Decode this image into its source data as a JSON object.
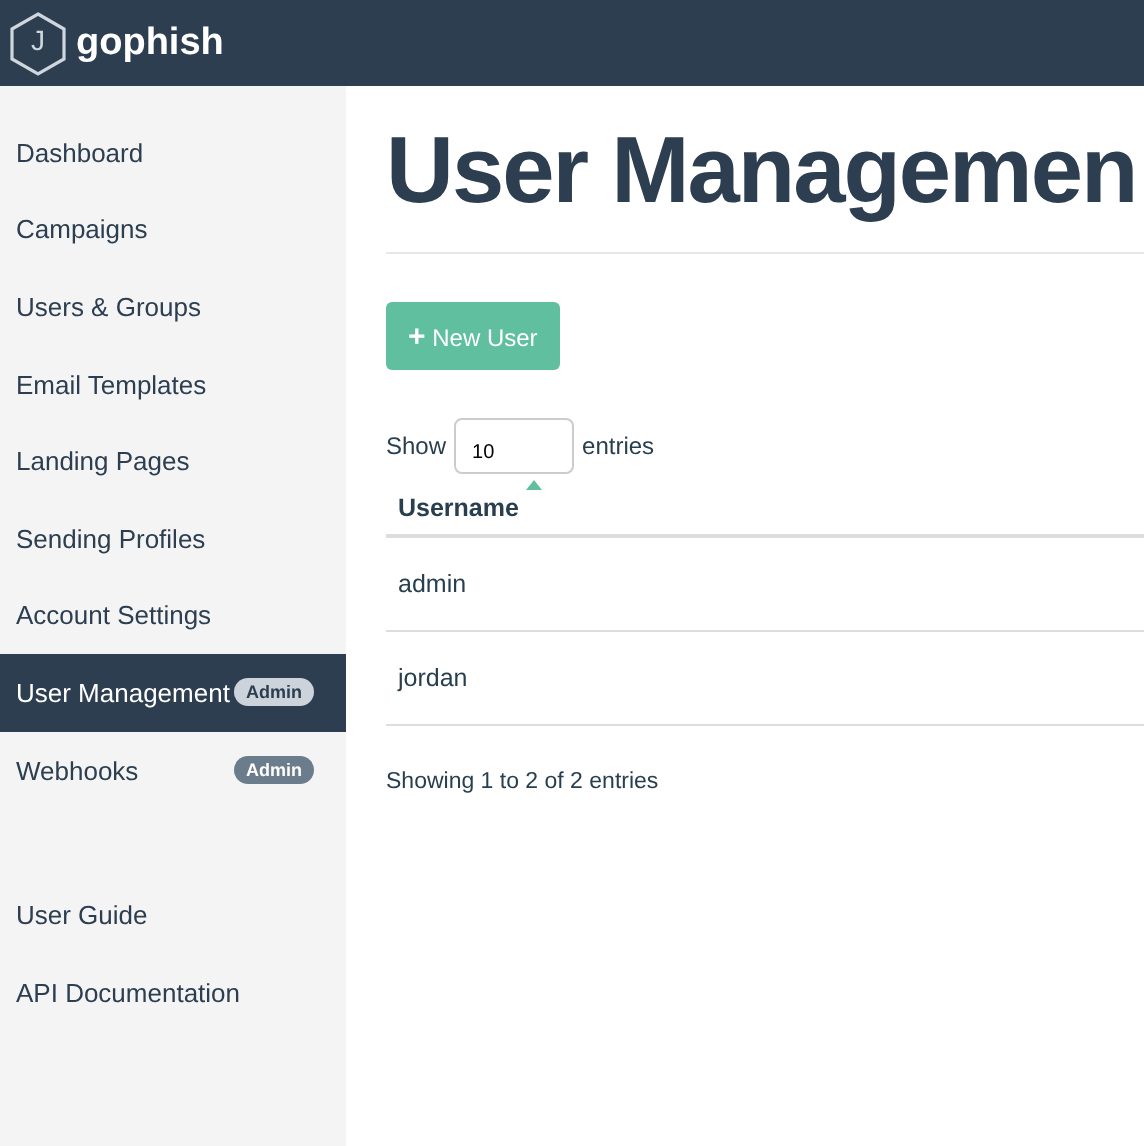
{
  "brand": {
    "name": "gophish",
    "logo_letter": "J"
  },
  "sidebar": {
    "items": [
      {
        "label": "Dashboard",
        "selected": false
      },
      {
        "label": "Campaigns",
        "selected": false
      },
      {
        "label": "Users & Groups",
        "selected": false
      },
      {
        "label": "Email Templates",
        "selected": false
      },
      {
        "label": "Landing Pages",
        "selected": false
      },
      {
        "label": "Sending Profiles",
        "selected": false
      },
      {
        "label": "Account Settings",
        "selected": false
      },
      {
        "label": "User Management",
        "selected": true,
        "badge": "Admin"
      },
      {
        "label": "Webhooks",
        "selected": false,
        "badge": "Admin"
      }
    ],
    "bottom_items": [
      {
        "label": "User Guide"
      },
      {
        "label": "API Documentation"
      }
    ]
  },
  "page": {
    "title": "User Managemen",
    "new_button": {
      "icon": "+",
      "label": "New User"
    },
    "length": {
      "prefix": "Show",
      "value": "10",
      "suffix": "entries"
    },
    "table": {
      "columns": [
        {
          "label": "Username",
          "sorted": true
        }
      ],
      "rows": [
        [
          "admin"
        ],
        [
          "jordan"
        ]
      ]
    },
    "info": "Showing 1 to 2 of 2 entries"
  }
}
